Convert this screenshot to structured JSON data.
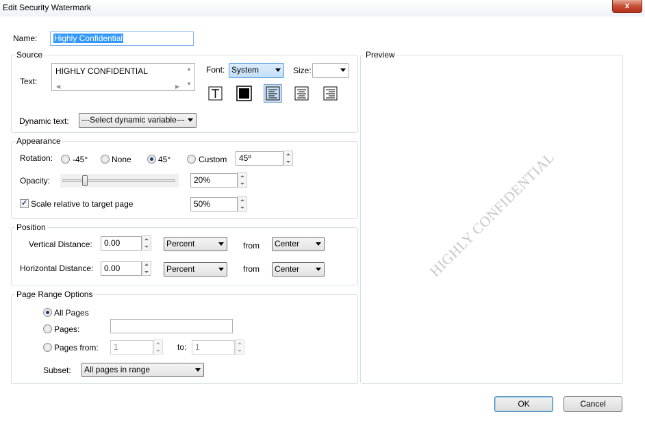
{
  "window": {
    "title": "Edit Security Watermark",
    "close_glyph": "x"
  },
  "name_field": {
    "label": "Name:",
    "value": "Highly Confidential"
  },
  "source": {
    "legend": "Source",
    "text_label": "Text:",
    "text_value": "HIGHLY CONFIDENTIAL",
    "font_label": "Font:",
    "font_value": "System",
    "size_label": "Size:",
    "size_value": "",
    "format_buttons": [
      {
        "icon": "text-outline-icon"
      },
      {
        "icon": "fill-color-icon"
      },
      {
        "icon": "align-left-icon",
        "active": true
      },
      {
        "icon": "align-center-icon"
      },
      {
        "icon": "align-right-icon"
      }
    ],
    "dynamic_text_label": "Dynamic text:",
    "dynamic_text_value": "---Select dynamic variable---"
  },
  "appearance": {
    "legend": "Appearance",
    "rotation_label": "Rotation:",
    "rotation_options": [
      "-45°",
      "None",
      "45°",
      "Custom"
    ],
    "rotation_selected": "45°",
    "custom_value": "45º",
    "opacity_label": "Opacity:",
    "opacity_value": "20%",
    "opacity_fraction": 0.2,
    "scale_label": "Scale relative to target page",
    "scale_checked": true,
    "scale_value": "50%"
  },
  "position": {
    "legend": "Position",
    "vertical_label": "Vertical Distance:",
    "vertical_value": "0.00",
    "vertical_unit": "Percent",
    "vertical_from_label": "from",
    "vertical_from": "Center",
    "horizontal_label": "Horizontal Distance:",
    "horizontal_value": "0.00",
    "horizontal_unit": "Percent",
    "horizontal_from_label": "from",
    "horizontal_from": "Center"
  },
  "page_range": {
    "legend": "Page Range Options",
    "all_pages_label": "All Pages",
    "pages_label": "Pages:",
    "pages_value": "",
    "pages_from_label": "Pages from:",
    "pages_from_value": "1",
    "to_label": "to:",
    "to_value": "1",
    "selected": "All Pages",
    "subset_label": "Subset:",
    "subset_value": "All pages in range"
  },
  "preview": {
    "legend": "Preview",
    "watermark_text": "HIGHLY CONFIDENTIAL",
    "watermark_color": "#c8c8c8"
  },
  "buttons": {
    "ok": "OK",
    "cancel": "Cancel"
  },
  "colors": {
    "group_border": "#d5dfe5",
    "selection_blue": "#3399ff",
    "close_red": "#c74d33"
  }
}
